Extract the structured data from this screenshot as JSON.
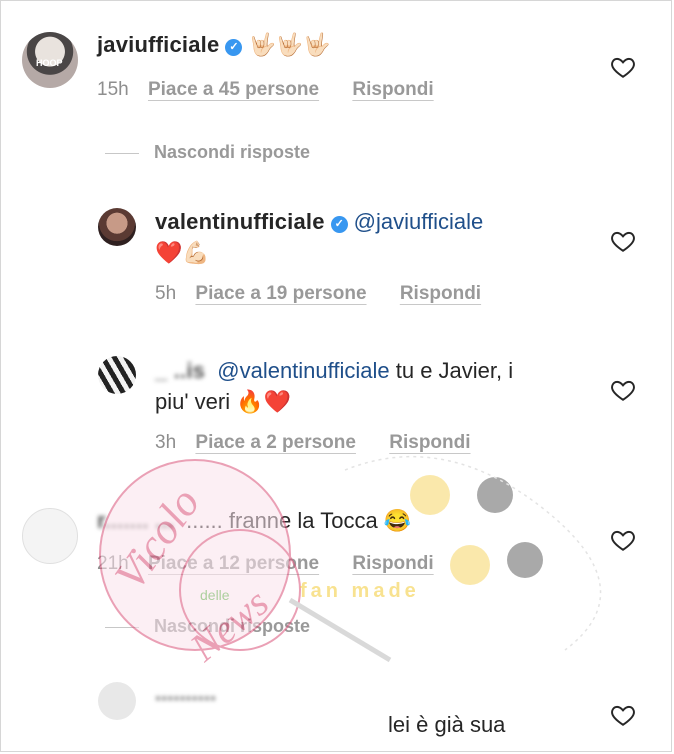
{
  "comments": [
    {
      "username": "javiufficiale",
      "verified": true,
      "text": "🤟🏻🤟🏻🤟🏻",
      "time": "15h",
      "likes": "Piace a 45 persone",
      "reply": "Rispondi"
    },
    {
      "username": "valentinufficiale",
      "verified": true,
      "mention": "@javiufficiale",
      "text": "❤️💪🏻",
      "time": "5h",
      "likes": "Piace a 19 persone",
      "reply": "Rispondi"
    },
    {
      "username": "_ ..is",
      "mention": "@valentinufficiale",
      "text": "tu e Javier, i",
      "text2": "piu' veri 🔥❤️",
      "time": "3h",
      "likes": "Piace a 2 persone",
      "reply": "Rispondi"
    },
    {
      "username": "r....... ...",
      "text": "...... franne la Tocca 😂",
      "time": "21h",
      "likes": "Piace a 12 persone",
      "reply": "Rispondi"
    },
    {
      "username": "..........",
      "text": "lei è già sua"
    }
  ],
  "toggles": {
    "first": "Nascondi risposte",
    "second": "Nascondi risposte"
  },
  "watermarks": {
    "vicolo": "Vicolo",
    "delle": "delle",
    "news": "News",
    "fan": "fan made"
  },
  "icons": {
    "like": "heart-outline-icon",
    "verified": "verified-badge-icon"
  },
  "colors": {
    "mention": "#1f4f8a",
    "verified": "#3897f0",
    "meta": "#8e8e8e",
    "watermark": "#d9537a"
  }
}
